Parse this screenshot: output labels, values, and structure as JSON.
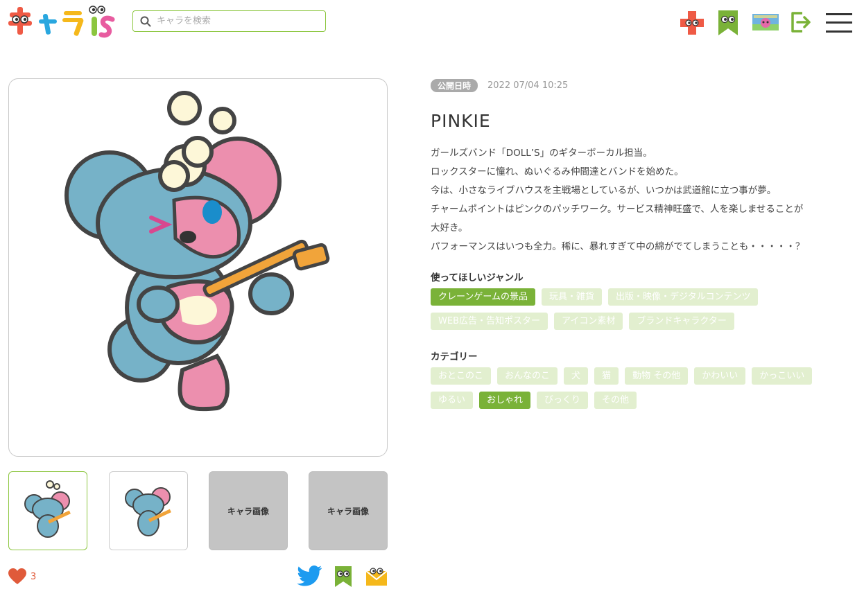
{
  "header": {
    "logo_text": "キャラis",
    "search_placeholder": "キャラを検索",
    "icons": [
      "add-icon",
      "bookmark-icon",
      "avatar",
      "logout-icon",
      "menu-icon"
    ]
  },
  "character": {
    "published_label": "公開日時",
    "published_date": "2022 07/04 10:25",
    "name": "PINKIE",
    "description": [
      "ガールズバンド「DOLL’S」のギターボーカル担当。",
      "ロックスターに憧れ、ぬいぐるみ仲間達とバンドを始めた。",
      "今は、小さなライブハウスを主戦場としているが、いつかは武道館に立つ事が夢。",
      "チャームポイントはピンクのパッチワーク。サービス精神旺盛で、人を楽しませることが",
      "大好き。",
      "パフォーマンスはいつも全力。稀に、暴れすぎて中の綿がでてしまうことも・・・・・？"
    ]
  },
  "genres": {
    "title": "使ってほしいジャンル",
    "items": [
      {
        "label": "クレーンゲームの景品",
        "selected": true
      },
      {
        "label": "玩具・雑貨",
        "selected": false
      },
      {
        "label": "出版・映像・デジタルコンテンツ",
        "selected": false
      },
      {
        "label": "WEB広告・告知ポスター",
        "selected": false
      },
      {
        "label": "アイコン素材",
        "selected": false
      },
      {
        "label": "ブランドキャラクター",
        "selected": false
      }
    ]
  },
  "categories": {
    "title": "カテゴリー",
    "items": [
      {
        "label": "おとこのこ",
        "selected": false
      },
      {
        "label": "おんなのこ",
        "selected": false
      },
      {
        "label": "犬",
        "selected": false
      },
      {
        "label": "猫",
        "selected": false
      },
      {
        "label": "動物 その他",
        "selected": false
      },
      {
        "label": "かわいい",
        "selected": false
      },
      {
        "label": "かっこいい",
        "selected": false
      },
      {
        "label": "ゆるい",
        "selected": false
      },
      {
        "label": "おしゃれ",
        "selected": true
      },
      {
        "label": "びっくり",
        "selected": false
      },
      {
        "label": "その他",
        "selected": false
      }
    ]
  },
  "thumbnails": [
    {
      "type": "image",
      "active": true
    },
    {
      "type": "image",
      "active": false
    },
    {
      "type": "placeholder",
      "label": "キャラ画像"
    },
    {
      "type": "placeholder",
      "label": "キャラ画像"
    }
  ],
  "likes": {
    "count": "3"
  },
  "share_icons": [
    "twitter-icon",
    "bookmark-icon",
    "mail-icon"
  ],
  "colors": {
    "accent": "#8cc63f",
    "tag_selected": "#7ab238",
    "tag_unselected": "#e2efcf",
    "like": "#e05a3a"
  }
}
